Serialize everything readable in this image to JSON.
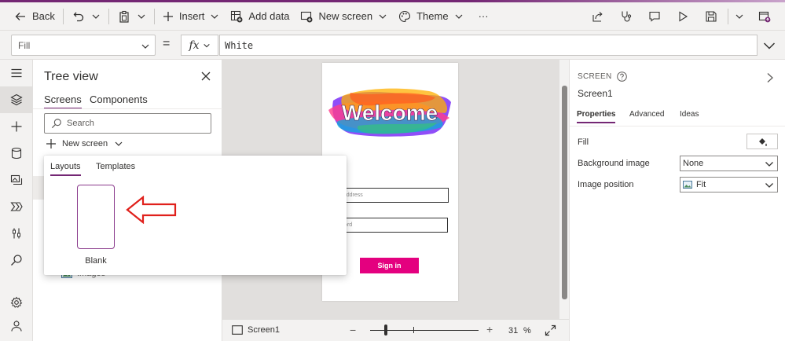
{
  "toolbar": {
    "back_label": "Back",
    "insert_label": "Insert",
    "add_data_label": "Add data",
    "new_screen_label": "New screen",
    "theme_label": "Theme",
    "more_label": "···"
  },
  "formula_bar": {
    "property": "Fill",
    "equals": "=",
    "fx_label": "fx",
    "formula": "White"
  },
  "tree_view": {
    "title": "Tree view",
    "tabs": [
      "Screens",
      "Components"
    ],
    "selected_tab": "Screens",
    "search_placeholder": "Search",
    "new_screen_label": "New screen",
    "visible_item": "Images"
  },
  "layouts_flyout": {
    "tabs": [
      "Layouts",
      "Templates"
    ],
    "selected_tab": "Layouts",
    "items": [
      {
        "label": "Blank"
      }
    ]
  },
  "canvas_preview": {
    "banner_text": "Welcome",
    "email_placeholder": "l Address",
    "password_placeholder": "word",
    "sign_in_label": "Sign in",
    "sign_in_color": "#e4007f"
  },
  "status_bar": {
    "screen_name": "Screen1",
    "zoom_value": "31",
    "zoom_unit": "%",
    "zoom_minus": "−",
    "zoom_plus": "+"
  },
  "properties_panel": {
    "kind": "SCREEN",
    "name": "Screen1",
    "tabs": [
      "Properties",
      "Advanced",
      "Ideas"
    ],
    "selected_tab": "Properties",
    "fill_label": "Fill",
    "fill_color": "#ffffff",
    "background_image_label": "Background image",
    "background_image_value": "None",
    "image_position_label": "Image position",
    "image_position_value": "Fit"
  },
  "colors": {
    "accent": "#742774",
    "annotation_arrow": "#e0201b"
  }
}
